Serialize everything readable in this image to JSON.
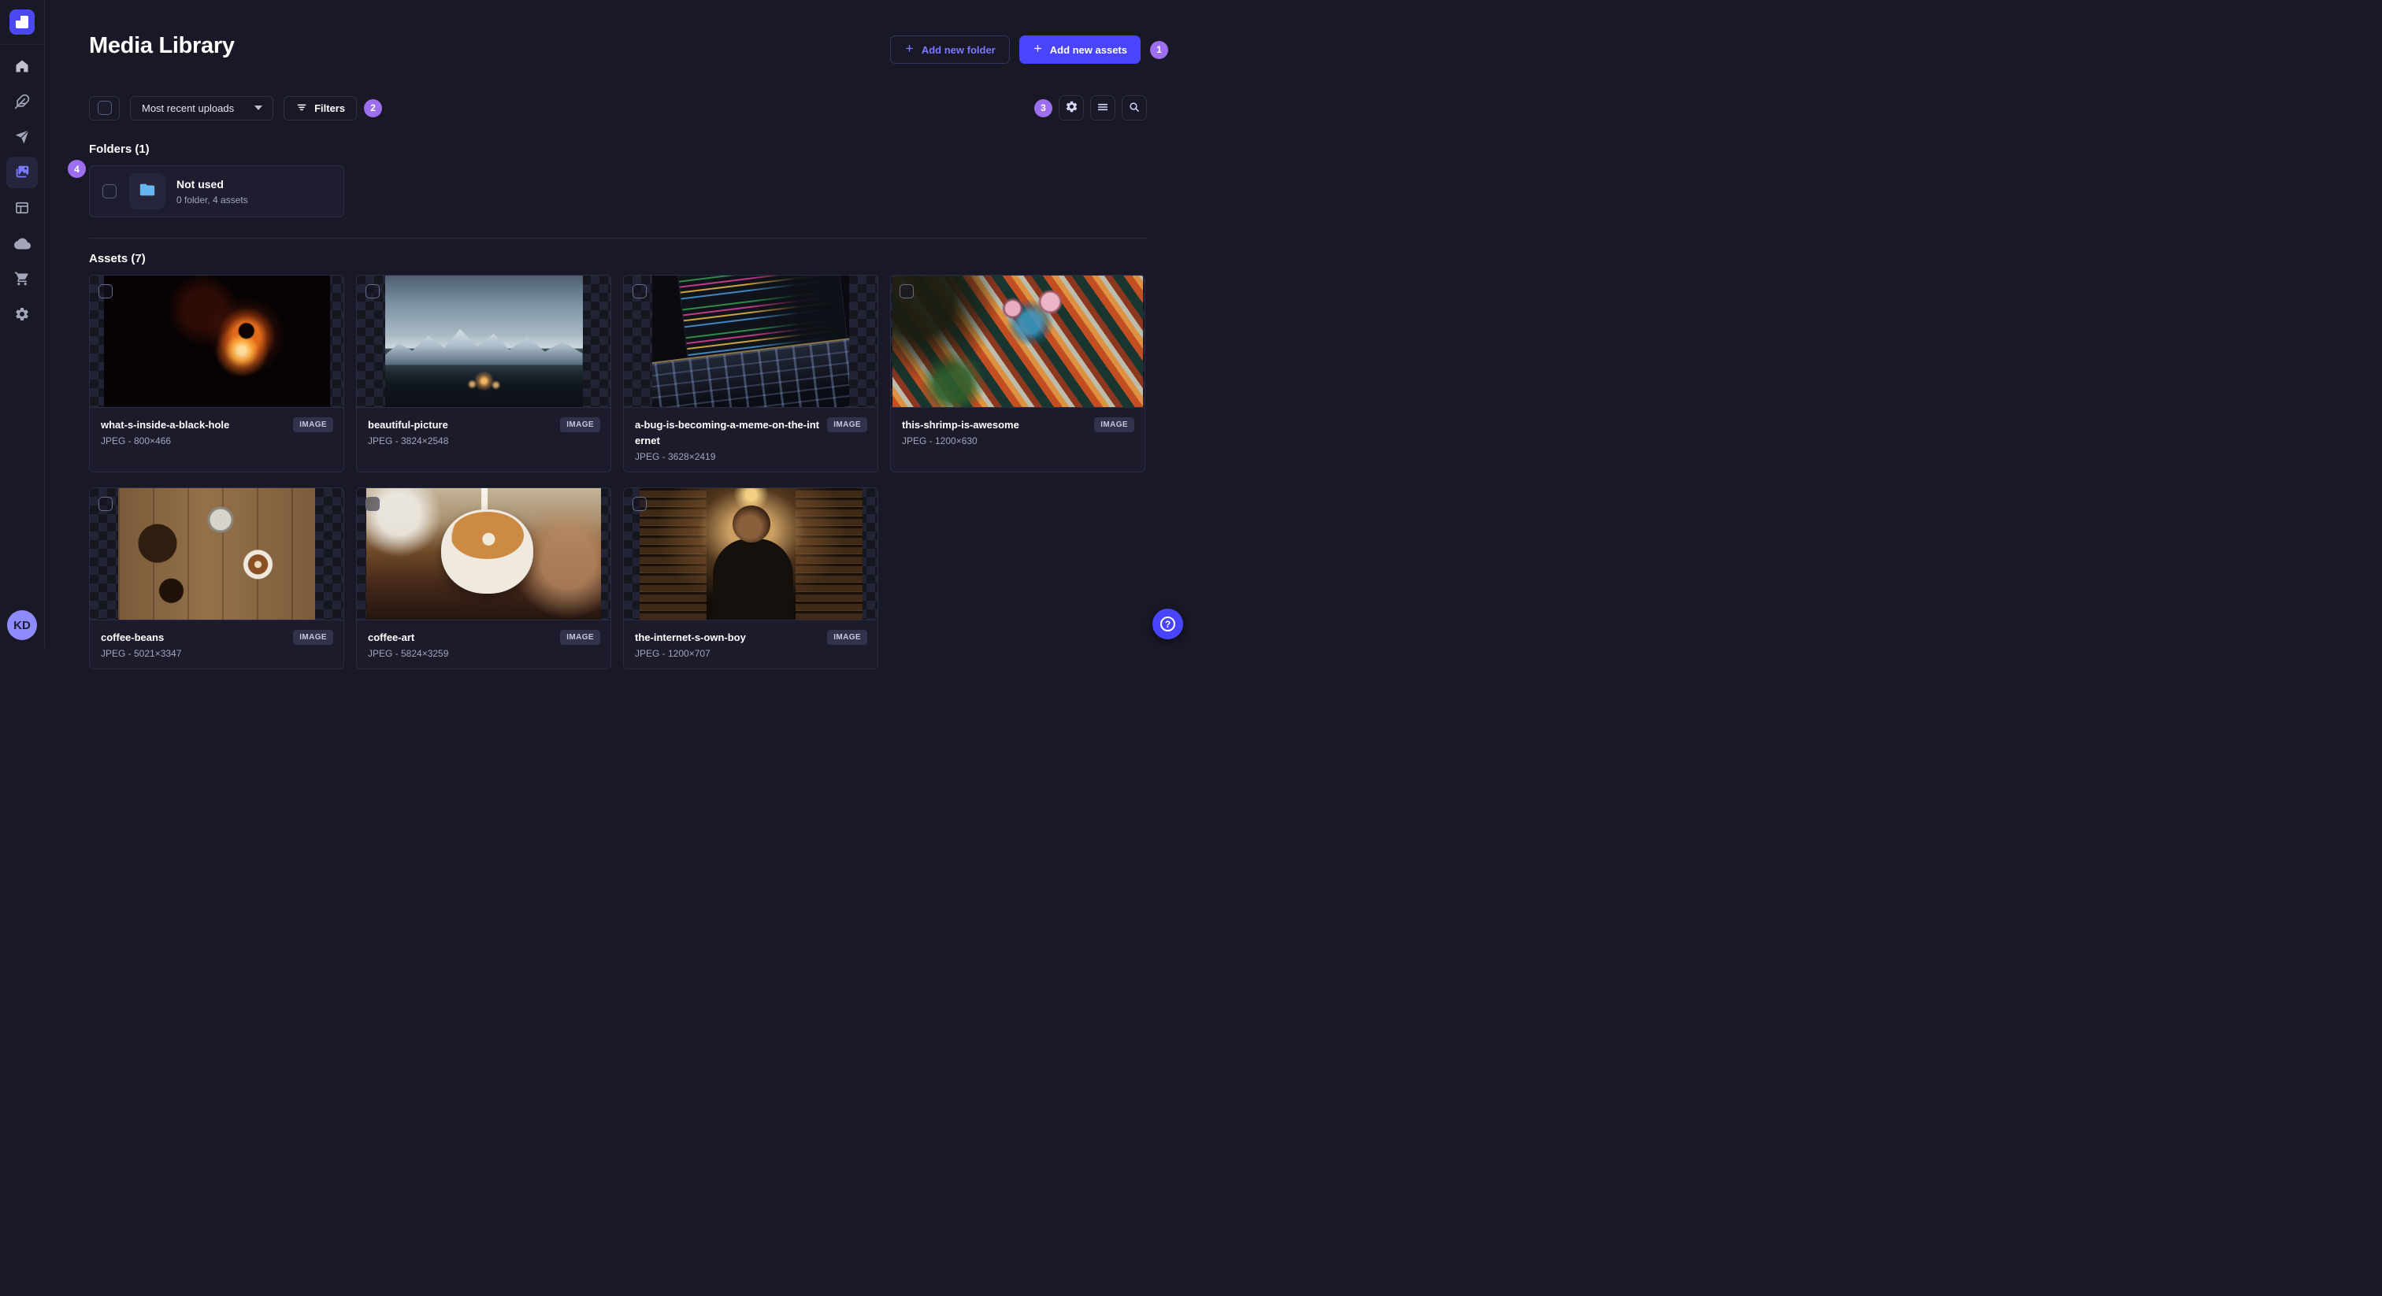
{
  "sidebar": {
    "logo_icon": "strapi-logo",
    "nav": [
      {
        "icon": "home-icon"
      },
      {
        "icon": "feather-icon"
      },
      {
        "icon": "paper-plane-icon"
      },
      {
        "icon": "images-icon",
        "active": true
      },
      {
        "icon": "layout-icon"
      },
      {
        "icon": "cloud-icon"
      },
      {
        "icon": "cart-icon"
      },
      {
        "icon": "gear-icon"
      }
    ],
    "avatar_initials": "KD"
  },
  "header": {
    "title": "Media Library",
    "add_folder_label": "Add new folder",
    "add_assets_label": "Add new assets"
  },
  "toolbar": {
    "sort_value": "Most recent uploads",
    "filters_label": "Filters",
    "view_icons": [
      "settings-icon",
      "list-icon",
      "search-icon"
    ]
  },
  "annotations": {
    "step1": "1",
    "step2": "2",
    "step3": "3",
    "step4": "4"
  },
  "folders": {
    "heading": "Folders (1)",
    "items": [
      {
        "name": "Not used",
        "meta": "0 folder, 4 assets"
      }
    ]
  },
  "assets": {
    "heading": "Assets (7)",
    "items": [
      {
        "name": "what-s-inside-a-black-hole",
        "meta": "JPEG - 800×466",
        "type_badge": "IMAGE"
      },
      {
        "name": "beautiful-picture",
        "meta": "JPEG - 3824×2548",
        "type_badge": "IMAGE"
      },
      {
        "name": "a-bug-is-becoming-a-meme-on-the-internet",
        "meta": "JPEG - 3628×2419",
        "type_badge": "IMAGE"
      },
      {
        "name": "this-shrimp-is-awesome",
        "meta": "JPEG - 1200×630",
        "type_badge": "IMAGE"
      },
      {
        "name": "coffee-beans",
        "meta": "JPEG - 5021×3347",
        "type_badge": "IMAGE"
      },
      {
        "name": "coffee-art",
        "meta": "JPEG - 5824×3259",
        "type_badge": "IMAGE"
      },
      {
        "name": "the-internet-s-own-boy",
        "meta": "JPEG - 1200×707",
        "type_badge": "IMAGE"
      }
    ]
  },
  "fab": {
    "help_glyph": "?"
  },
  "colors": {
    "primary": "#4945ff",
    "step_badge": "#9d6ff0",
    "folder_icon": "#66b7f1",
    "background": "#181826"
  }
}
